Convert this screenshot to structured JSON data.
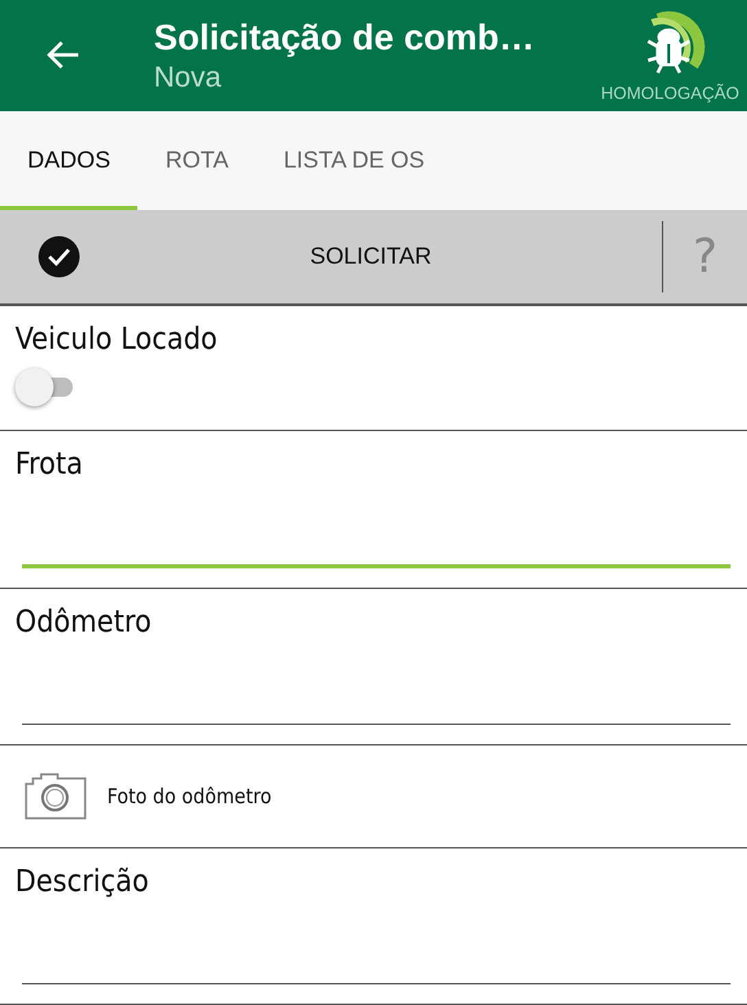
{
  "header": {
    "title": "Solicitação de comb…",
    "subtitle": "Nova",
    "badge": "HOMOLOGAÇÃO"
  },
  "tabs": [
    {
      "label": "DADOS",
      "selected": true
    },
    {
      "label": "ROTA",
      "selected": false
    },
    {
      "label": "LISTA DE OS",
      "selected": false
    }
  ],
  "action_bar": {
    "label": "SOLICITAR",
    "help": "?"
  },
  "fields": [
    {
      "kind": "switch",
      "label": "Veiculo Locado",
      "on": false
    },
    {
      "kind": "text",
      "label": "Frota",
      "focused": true
    },
    {
      "kind": "text",
      "label": "Odômetro",
      "focused": false
    },
    {
      "kind": "photo",
      "label": "Foto do odômetro"
    },
    {
      "kind": "text",
      "label": "Descrição",
      "focused": false
    }
  ]
}
